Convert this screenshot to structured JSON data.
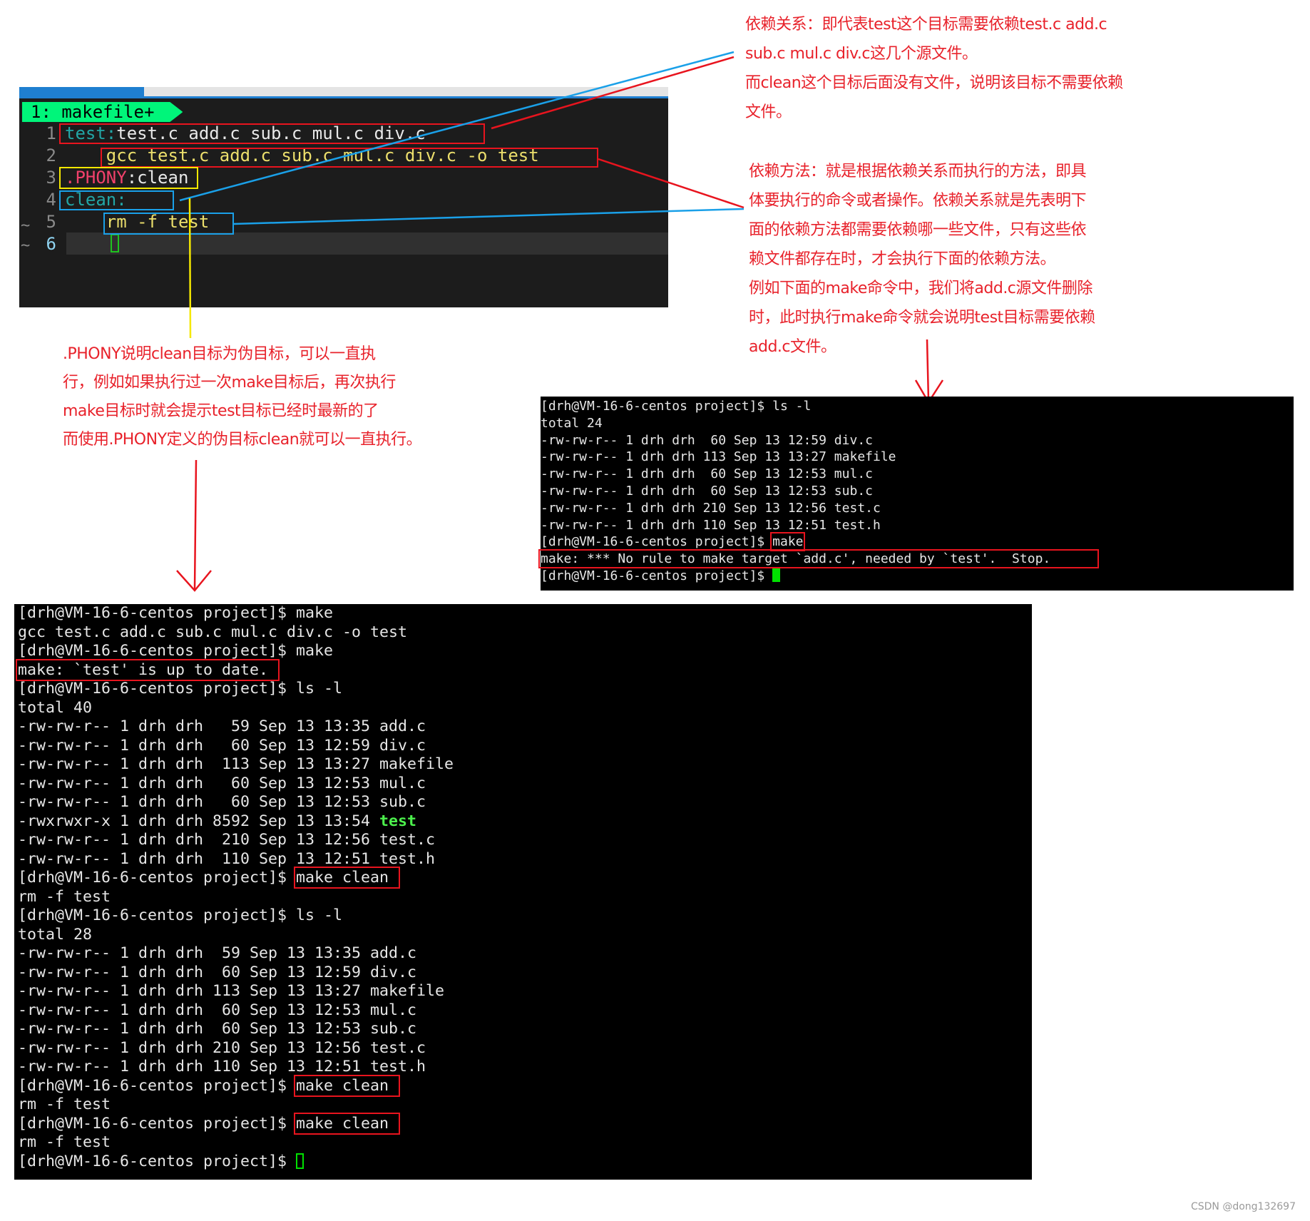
{
  "editor": {
    "buffer_name": "1: makefile+",
    "lines": [
      {
        "num": "1",
        "parts": [
          {
            "t": "test:",
            "c": "teal"
          },
          {
            "t": "test.c add.c sub.c mul.c div.c",
            "c": ""
          }
        ]
      },
      {
        "num": "2",
        "parts": [
          {
            "t": "    gcc test.c add.c sub.c mul.c div.c -o test",
            "c": "yel"
          }
        ]
      },
      {
        "num": "3",
        "parts": [
          {
            "t": ".PHONY",
            "c": "pink"
          },
          {
            "t": ":clean",
            "c": ""
          }
        ]
      },
      {
        "num": "4",
        "parts": [
          {
            "t": "clean:",
            "c": "teal"
          }
        ]
      },
      {
        "num": "5",
        "parts": [
          {
            "t": "    rm -f test",
            "c": "yel"
          }
        ]
      },
      {
        "num": "6",
        "parts": []
      }
    ],
    "tilde": "~"
  },
  "annotations": {
    "dependency": "依赖关系：即代表test这个目标需要依赖test.c add.c\nsub.c mul.c div.c这几个源文件。\n而clean这个目标后面没有文件，说明该目标不需要依赖\n文件。",
    "method": "依赖方法：就是根据依赖关系而执行的方法，即具\n体要执行的命令或者操作。依赖关系就是先表明下\n面的依赖方法都需要依赖哪一些文件，只有这些依\n赖文件都存在时，才会执行下面的依赖方法。\n例如下面的make命令中，我们将add.c源文件删除\n时，此时执行make命令就会说明test目标需要依赖\nadd.c文件。",
    "phony": ".PHONY说明clean目标为伪目标，可以一直执\n行，例如如果执行过一次make目标后，再次执行\nmake目标时就会提示test目标已经时最新的了\n而使用.PHONY定义的伪目标clean就可以一直执行。"
  },
  "terminal_right": {
    "lines": [
      {
        "pre": "[drh@VM-16-6-centos project]$ ls -l"
      },
      {
        "pre": "total 24"
      },
      {
        "pre": "-rw-rw-r-- 1 drh drh  60 Sep 13 12:59 div.c"
      },
      {
        "pre": "-rw-rw-r-- 1 drh drh 113 Sep 13 13:27 makefile"
      },
      {
        "pre": "-rw-rw-r-- 1 drh drh  60 Sep 13 12:53 mul.c"
      },
      {
        "pre": "-rw-rw-r-- 1 drh drh  60 Sep 13 12:53 sub.c"
      },
      {
        "pre": "-rw-rw-r-- 1 drh drh 210 Sep 13 12:56 test.c"
      },
      {
        "pre": "-rw-rw-r-- 1 drh drh 110 Sep 13 12:51 test.h"
      },
      {
        "pre": "[drh@VM-16-6-centos project]$",
        "box": "make"
      },
      {
        "box": "make: *** No rule to make target `add.c', needed by `test'.  Stop.      "
      },
      {
        "pre": "[drh@VM-16-6-centos project]$ ",
        "cursor": "block"
      }
    ]
  },
  "terminal_bottom": {
    "lines": [
      {
        "pre": "[drh@VM-16-6-centos project]$ make"
      },
      {
        "pre": "gcc test.c add.c sub.c mul.c div.c -o test"
      },
      {
        "pre": "[drh@VM-16-6-centos project]$ make"
      },
      {
        "box": "make: `test' is up to date. "
      },
      {
        "pre": "[drh@VM-16-6-centos project]$ ls -l"
      },
      {
        "pre": "total 40"
      },
      {
        "pre": "-rw-rw-r-- 1 drh drh   59 Sep 13 13:35 add.c"
      },
      {
        "pre": "-rw-rw-r-- 1 drh drh   60 Sep 13 12:59 div.c"
      },
      {
        "pre": "-rw-rw-r-- 1 drh drh  113 Sep 13 13:27 makefile"
      },
      {
        "pre": "-rw-rw-r-- 1 drh drh   60 Sep 13 12:53 mul.c"
      },
      {
        "pre": "-rw-rw-r-- 1 drh drh   60 Sep 13 12:53 sub.c"
      },
      {
        "pre": "-rwxrwxr-x 1 drh drh 8592 Sep 13 13:54 ",
        "green": "test"
      },
      {
        "pre": "-rw-rw-r-- 1 drh drh  210 Sep 13 12:56 test.c"
      },
      {
        "pre": "-rw-rw-r-- 1 drh drh  110 Sep 13 12:51 test.h"
      },
      {
        "pre": "[drh@VM-16-6-centos project]$",
        "box": "make clean "
      },
      {
        "pre": "rm -f test"
      },
      {
        "pre": "[drh@VM-16-6-centos project]$ ls -l"
      },
      {
        "pre": "total 28"
      },
      {
        "pre": "-rw-rw-r-- 1 drh drh  59 Sep 13 13:35 add.c"
      },
      {
        "pre": "-rw-rw-r-- 1 drh drh  60 Sep 13 12:59 div.c"
      },
      {
        "pre": "-rw-rw-r-- 1 drh drh 113 Sep 13 13:27 makefile"
      },
      {
        "pre": "-rw-rw-r-- 1 drh drh  60 Sep 13 12:53 mul.c"
      },
      {
        "pre": "-rw-rw-r-- 1 drh drh  60 Sep 13 12:53 sub.c"
      },
      {
        "pre": "-rw-rw-r-- 1 drh drh 210 Sep 13 12:56 test.c"
      },
      {
        "pre": "-rw-rw-r-- 1 drh drh 110 Sep 13 12:51 test.h"
      },
      {
        "pre": "[drh@VM-16-6-centos project]$",
        "box": "make clean "
      },
      {
        "pre": "rm -f test"
      },
      {
        "pre": "[drh@VM-16-6-centos project]$",
        "box": "make clean "
      },
      {
        "pre": "rm -f test"
      },
      {
        "pre": "[drh@VM-16-6-centos project]$ ",
        "cursor": "hollow"
      }
    ]
  },
  "watermark": "CSDN @dong132697",
  "colors": {
    "annotation_red": "#e8222b",
    "highlight_yellow": "#f5e800",
    "highlight_blue": "#1aa0e8",
    "buffer_tab_green": "#00f57a",
    "cursor_green": "#00e000"
  }
}
